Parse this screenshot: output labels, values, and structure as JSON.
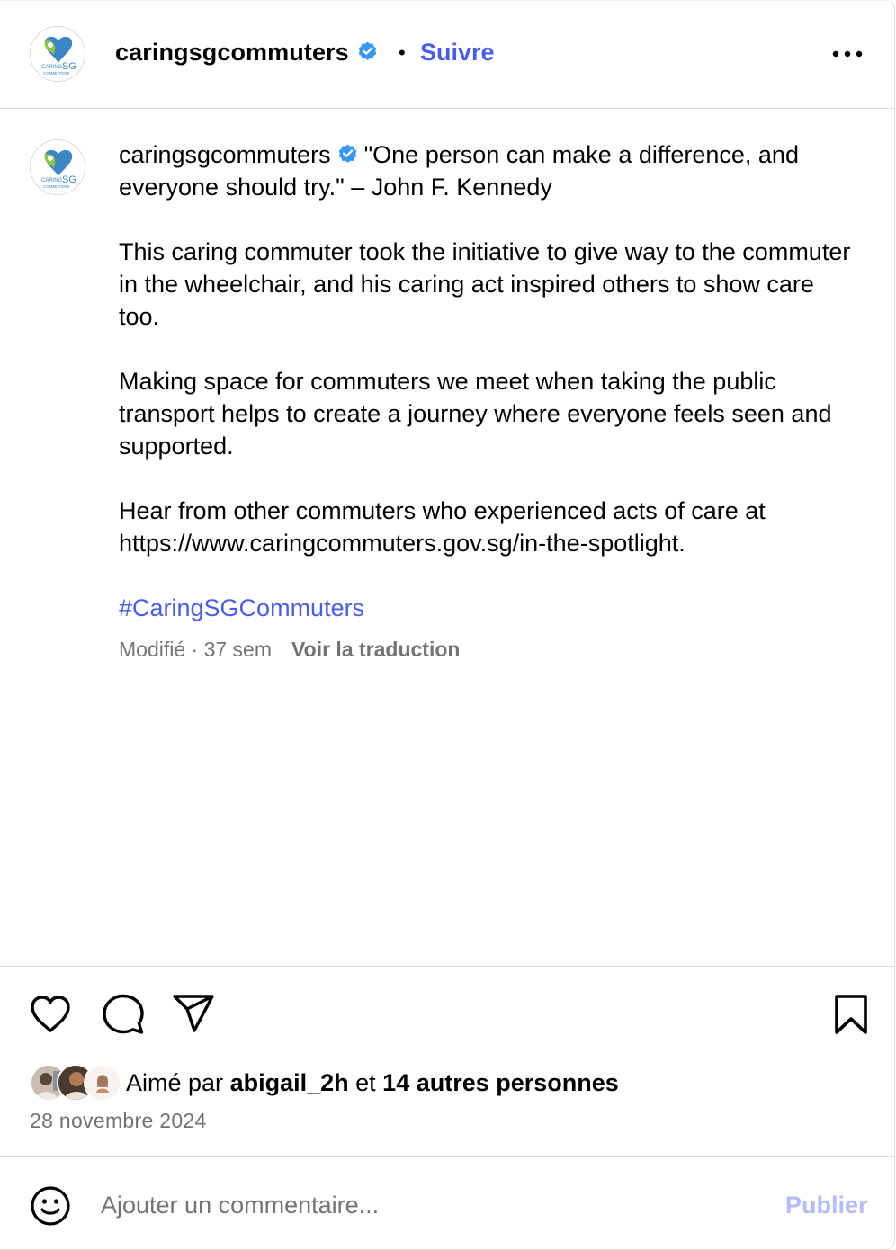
{
  "header": {
    "username": "caringsgcommuters",
    "separator": "•",
    "follow_label": "Suivre",
    "more_icon": "more-horizontal-icon"
  },
  "caption": {
    "username": "caringsgcommuters",
    "quote": "\"One person can make a difference, and everyone should try.\" – John F. Kennedy",
    "paragraph1": "This caring commuter took the initiative to give way to the commuter in the wheelchair, and his caring act inspired others to show care too.",
    "paragraph2": "Making space for commuters we meet when taking the public transport helps to create a journey where everyone feels seen and supported.",
    "paragraph3": "Hear from other commuters who experienced acts of care at https://www.caringcommuters.gov.sg/in-the-spotlight.",
    "hashtag": "#CaringSGCommuters",
    "meta": "Modifié · 37 sem",
    "translate_label": "Voir la traduction"
  },
  "actions": {
    "like_icon": "heart-icon",
    "comment_icon": "comment-icon",
    "share_icon": "share-icon",
    "save_icon": "bookmark-icon"
  },
  "likes": {
    "prefix": "Aimé par",
    "user": "abigail_2h",
    "conjunction": "et",
    "others": "14 autres personnes"
  },
  "date": "28 novembre 2024",
  "comment": {
    "placeholder": "Ajouter un commentaire...",
    "publish_label": "Publier",
    "emoji_icon": "emoji-icon"
  },
  "colors": {
    "accent": "#4a5de8",
    "publish_disabled": "#b3bdf8",
    "muted": "#737373",
    "verified": "#3897f0"
  }
}
